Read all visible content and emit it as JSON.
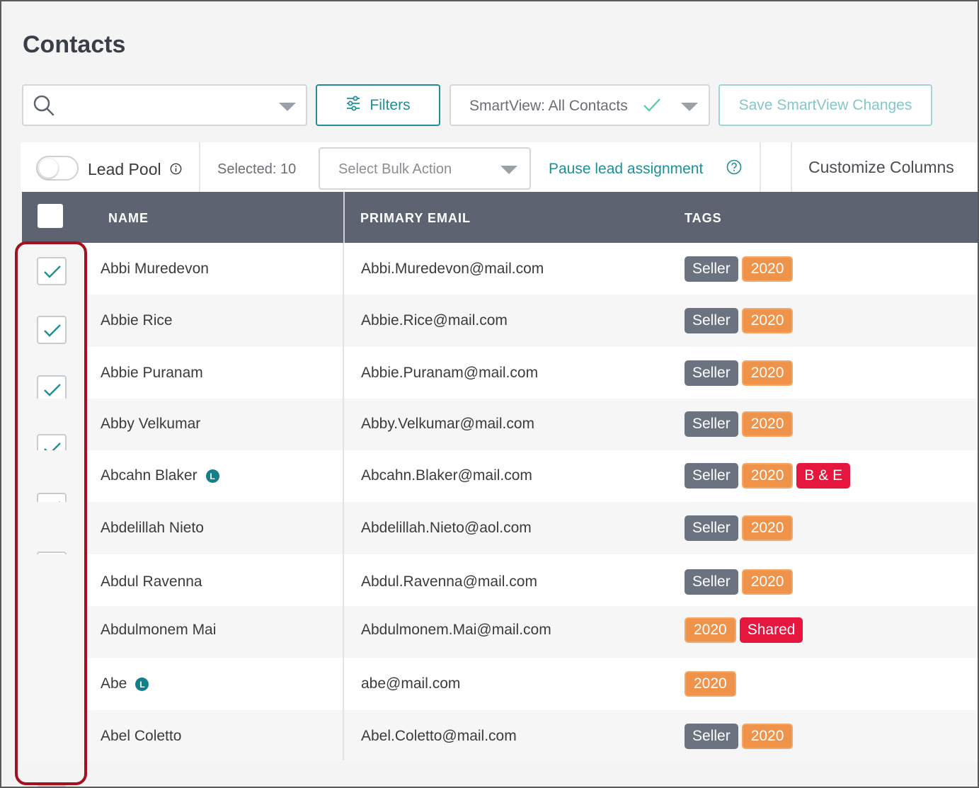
{
  "page": {
    "title": "Contacts"
  },
  "toolbar": {
    "search_placeholder": "",
    "filters_label": "Filters",
    "smartview_label": "SmartView: All Contacts",
    "save_smartview_label": "Save SmartView Changes"
  },
  "subbar": {
    "lead_pool_label": "Lead Pool",
    "selected_label": "Selected: 10",
    "bulk_action_placeholder": "Select Bulk Action",
    "pause_label": "Pause lead assignment",
    "customize_label": "Customize Columns"
  },
  "table": {
    "headers": {
      "name": "NAME",
      "email": "PRIMARY EMAIL",
      "tags": "TAGS"
    },
    "rows": [
      {
        "name": "Abbi Muredevon",
        "email": "Abbi.Muredevon@mail.com",
        "lead": false,
        "checked": true,
        "tags": [
          "Seller",
          "2020"
        ]
      },
      {
        "name": "Abbie Rice",
        "email": "Abbie.Rice@mail.com",
        "lead": false,
        "checked": true,
        "tags": [
          "Seller",
          "2020"
        ]
      },
      {
        "name": "Abbie Puranam",
        "email": "Abbie.Puranam@mail.com",
        "lead": false,
        "checked": true,
        "tags": [
          "Seller",
          "2020"
        ]
      },
      {
        "name": "Abby Velkumar",
        "email": "Abby.Velkumar@mail.com",
        "lead": false,
        "checked": true,
        "tags": [
          "Seller",
          "2020"
        ]
      },
      {
        "name": "Abcahn Blaker",
        "email": "Abcahn.Blaker@mail.com",
        "lead": true,
        "checked": true,
        "tags": [
          "Seller",
          "2020",
          "B & E"
        ]
      },
      {
        "name": "Abdelillah Nieto",
        "email": "Abdelillah.Nieto@aol.com",
        "lead": false,
        "checked": true,
        "tags": [
          "Seller",
          "2020"
        ]
      },
      {
        "name": "Abdul Ravenna",
        "email": "Abdul.Ravenna@mail.com",
        "lead": false,
        "checked": true,
        "tags": [
          "Seller",
          "2020"
        ]
      },
      {
        "name": "Abdulmonem Mai",
        "email": "Abdulmonem.Mai@mail.com",
        "lead": false,
        "checked": true,
        "tags": [
          "2020",
          "Shared"
        ]
      },
      {
        "name": "Abe",
        "email": "abe@mail.com",
        "lead": true,
        "checked": true,
        "tags": [
          "2020"
        ]
      },
      {
        "name": "Abel Coletto",
        "email": "Abel.Coletto@mail.com",
        "lead": false,
        "checked": true,
        "tags": [
          "Seller",
          "2020"
        ]
      }
    ],
    "lead_badge_letter": "L"
  },
  "colors": {
    "accent": "#1e8f97",
    "header_bg": "#5d6370",
    "tag_seller": "#6c7380",
    "tag_year": "#f0934a",
    "tag_red": "#e5173f",
    "highlight": "#a4101e"
  }
}
